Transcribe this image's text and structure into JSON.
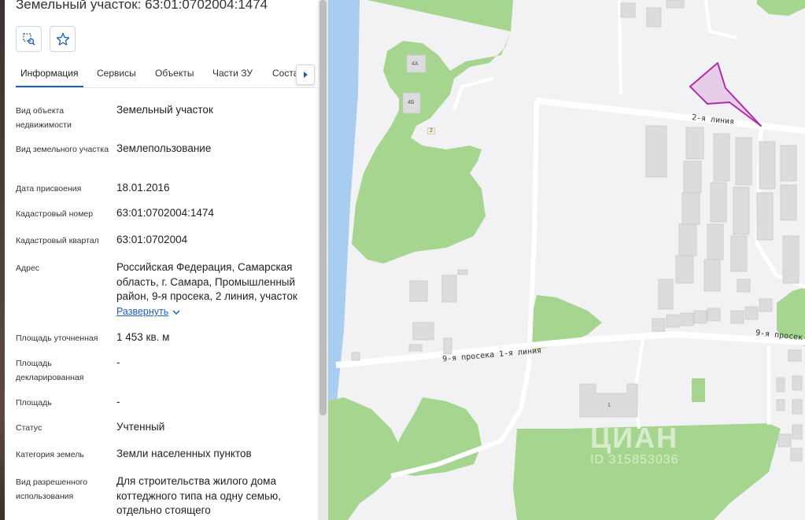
{
  "panel": {
    "title": "Земельный участок: 63:01:0702004:1474",
    "tools": [
      {
        "icon": "select-area-icon"
      },
      {
        "icon": "star-icon"
      }
    ],
    "tabs": [
      "Информация",
      "Сервисы",
      "Объекты",
      "Части ЗУ",
      "Соста"
    ],
    "active_tab": "Информация",
    "rows": [
      {
        "label": "Вид объекта недвижимости",
        "value": "Земельный участок"
      },
      {
        "label": "Вид земельного участка",
        "value": "Землепользование"
      },
      {
        "label": "Дата присвоения",
        "value": "18.01.2016"
      },
      {
        "label": "Кадастровый номер",
        "value": "63:01:0702004:1474"
      },
      {
        "label": "Кадастровый квартал",
        "value": "63:01:0702004"
      },
      {
        "label": "Адрес",
        "value": "Российская Федерация, Самарская область, г. Самара, Промышленный район, 9-я просека, 2 линия, участок"
      },
      {
        "label": "Площадь уточненная",
        "value": "1 453 кв. м"
      },
      {
        "label": "Площадь декларированная",
        "value": "-"
      },
      {
        "label": "Площадь",
        "value": "-"
      },
      {
        "label": "Статус",
        "value": "Учтенный"
      },
      {
        "label": "Категория земель",
        "value": "Земли населенных пунктов"
      },
      {
        "label": "Вид разрешенного использования",
        "value": "Для строительства жилого дома коттеджного типа на одну семью, отдельно стоящего"
      }
    ],
    "expand_label": "Развернуть"
  },
  "map": {
    "street_labels": [
      "2-я линия",
      "9-я просека 1-я линия",
      "9-я просек"
    ],
    "building_numbers": [
      "4А",
      "4Б",
      "2",
      "1"
    ],
    "watermark": {
      "logo": "ЦИАН",
      "id": "ID 315853036"
    },
    "colors": {
      "green": "#a6d58f",
      "water": "#a9cdf0",
      "road": "#ffffff",
      "parcel_fill": "#e7cde8",
      "parcel_stroke": "#b02da6",
      "building": "#dcdcde"
    }
  }
}
